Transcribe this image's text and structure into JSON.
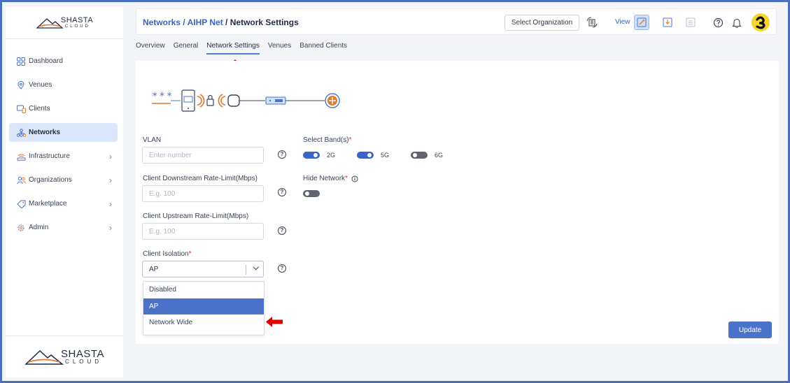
{
  "brand": {
    "name": "SHASTA",
    "sub": "CLOUD"
  },
  "sidebar": {
    "items": [
      {
        "label": "Dashboard",
        "icon": "dashboard-icon",
        "active": false,
        "has_children": false
      },
      {
        "label": "Venues",
        "icon": "location-pin-icon",
        "active": false,
        "has_children": false
      },
      {
        "label": "Clients",
        "icon": "devices-icon",
        "active": false,
        "has_children": false
      },
      {
        "label": "Networks",
        "icon": "network-icon",
        "active": true,
        "has_children": false
      },
      {
        "label": "Infrastructure",
        "icon": "wifi-router-icon",
        "active": false,
        "has_children": true
      },
      {
        "label": "Organizations",
        "icon": "users-icon",
        "active": false,
        "has_children": true
      },
      {
        "label": "Marketplace",
        "icon": "tag-icon",
        "active": false,
        "has_children": true
      },
      {
        "label": "Admin",
        "icon": "gear-icon",
        "active": false,
        "has_children": true
      }
    ]
  },
  "header": {
    "breadcrumb": {
      "part1": "Networks",
      "sep1": " / ",
      "part2": "AIHP Net",
      "sep2": " / ",
      "current": "Network Settings"
    },
    "select_org_label": "Select Organization",
    "view_label": "View"
  },
  "tabs": [
    {
      "label": "Overview",
      "active": false
    },
    {
      "label": "General",
      "active": false
    },
    {
      "label": "Network Settings",
      "active": true
    },
    {
      "label": "Venues",
      "active": false
    },
    {
      "label": "Banned Clients",
      "active": false
    }
  ],
  "diagram": {
    "password_mask": "***"
  },
  "form": {
    "vlan": {
      "label": "VLAN",
      "placeholder": "Enter number"
    },
    "downstream": {
      "label": "Client Downstream Rate-Limit(Mbps)",
      "placeholder": "E.g. 100"
    },
    "upstream": {
      "label": "Client Upstream Rate-Limit(Mbps)",
      "placeholder": "E.g. 100"
    },
    "isolation": {
      "label": "Client Isolation",
      "required_mark": "*",
      "value": "AP"
    },
    "bands": {
      "label": "Select Band(s)",
      "required_mark": "*",
      "items": [
        {
          "label": "2G",
          "on": true
        },
        {
          "label": "5G",
          "on": true
        },
        {
          "label": "6G",
          "on": false
        }
      ]
    },
    "hide_network": {
      "label": "Hide Network",
      "required_mark": "*",
      "on": false
    }
  },
  "dropdown": {
    "options": [
      {
        "label": "Disabled",
        "selected": false
      },
      {
        "label": "AP",
        "selected": true
      },
      {
        "label": "Network Wide",
        "selected": false
      }
    ]
  },
  "update_button": "Update",
  "colors": {
    "accent": "#4a73c9",
    "annotation_arrow": "#e00000",
    "frame": "#4a6fbf"
  }
}
